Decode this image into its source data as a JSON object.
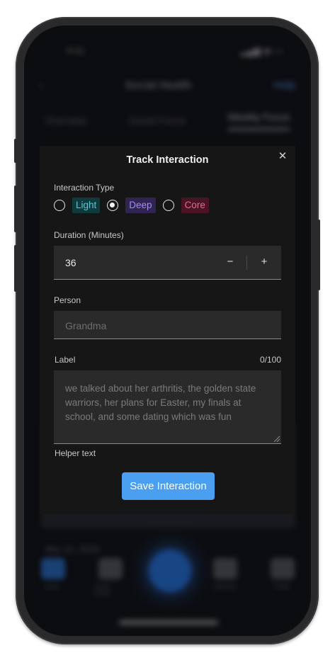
{
  "background": {
    "status_time": "9:41",
    "header_title": "Social Health",
    "header_action": "Help",
    "tabs": [
      "Overview",
      "Social Focus",
      "Weekly Focus"
    ],
    "date": "Mar 21, 2024",
    "nav": [
      "Home",
      "Social Guide",
      "",
      "Calendar",
      "Profile"
    ]
  },
  "modal": {
    "title": "Track Interaction",
    "close_icon": "close-icon",
    "interaction_type_label": "Interaction Type",
    "options": [
      {
        "label": "Light",
        "checked": false,
        "color": "#59c8d0"
      },
      {
        "label": "Deep",
        "checked": true,
        "color": "#a48cf0"
      },
      {
        "label": "Core",
        "checked": false,
        "color": "#e56a8a"
      }
    ],
    "duration_label": "Duration (Minutes)",
    "duration_value": "36",
    "decrement": "−",
    "increment": "+",
    "person_label": "Person",
    "person_placeholder": "Grandma",
    "label_label": "Label",
    "label_counter": "0/100",
    "label_placeholder": "we talked about her arthritis, the golden state warriors, her plans for Easter, my finals at school, and some dating which was fun",
    "helper_text": "Helper text",
    "save_label": "Save Interaction",
    "accent": "#4a9ff1"
  }
}
